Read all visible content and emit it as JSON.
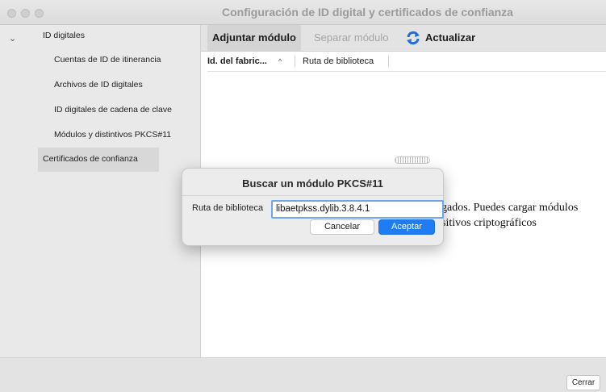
{
  "window": {
    "title": "Configuración de ID digital y certificados de confianza"
  },
  "sidebar": {
    "items": [
      {
        "label": "ID digitales"
      },
      {
        "label": "Cuentas de ID de itinerancia"
      },
      {
        "label": "Archivos de ID digitales"
      },
      {
        "label": "ID digitales de cadena de clave"
      },
      {
        "label": "Módulos y distintivos PKCS#11"
      },
      {
        "label": "Certificados de confianza"
      }
    ]
  },
  "toolbar": {
    "attach_label": "Adjuntar módulo",
    "detach_label": "Separar módulo",
    "refresh_label": "Actualizar"
  },
  "table": {
    "columns": [
      "Id. del fabric...",
      "Ruta de biblioteca"
    ],
    "sort_indicator": "^"
  },
  "background_text": {
    "line1": "gados. Puedes cargar módulos",
    "line2": "sitivos criptográficos"
  },
  "footer": {
    "close_label": "Cerrar"
  },
  "dialog": {
    "title": "Buscar un módulo PKCS#11",
    "field_label": "Ruta de biblioteca",
    "field_value": "libaetpkss.dylib.3.8.4.1",
    "cancel_label": "Cancelar",
    "ok_label": "Aceptar"
  },
  "colors": {
    "accent": "#1e7df5",
    "focus_ring": "#6ea6ea",
    "refresh_icon": "#1f6fd6"
  }
}
